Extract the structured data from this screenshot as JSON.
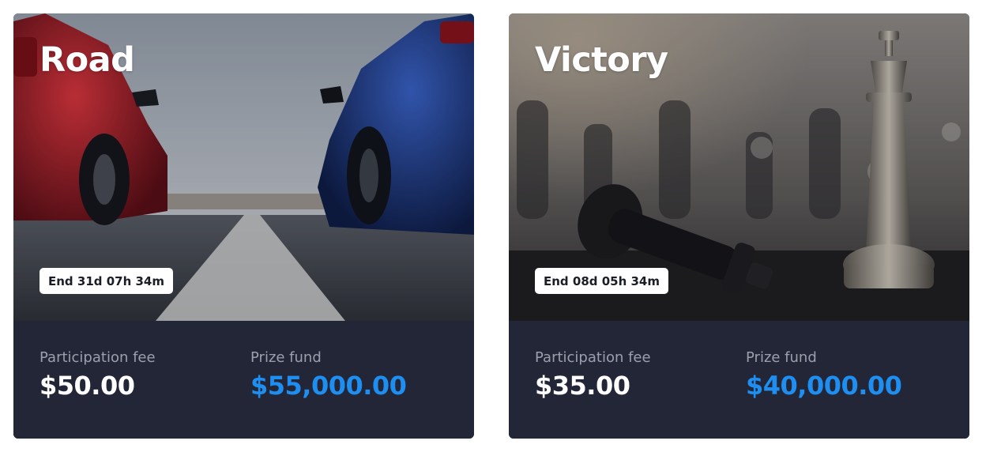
{
  "colors": {
    "card_bg": "#222637",
    "label_gray": "#9ba0ad",
    "prize_blue": "#1e8ef0",
    "badge_bg": "#ffffff"
  },
  "cards": [
    {
      "title": "Road",
      "timer": "End 31d 07h 34m",
      "fee_label": "Participation fee",
      "fee_value": "$50.00",
      "prize_label": "Prize fund",
      "prize_value": "$55,000.00",
      "image": "drag-race-cars-photo"
    },
    {
      "title": "Victory",
      "timer": "End 08d 05h 34m",
      "fee_label": "Participation fee",
      "fee_value": "$35.00",
      "prize_label": "Prize fund",
      "prize_value": "$40,000.00",
      "image": "chess-pieces-photo"
    }
  ]
}
